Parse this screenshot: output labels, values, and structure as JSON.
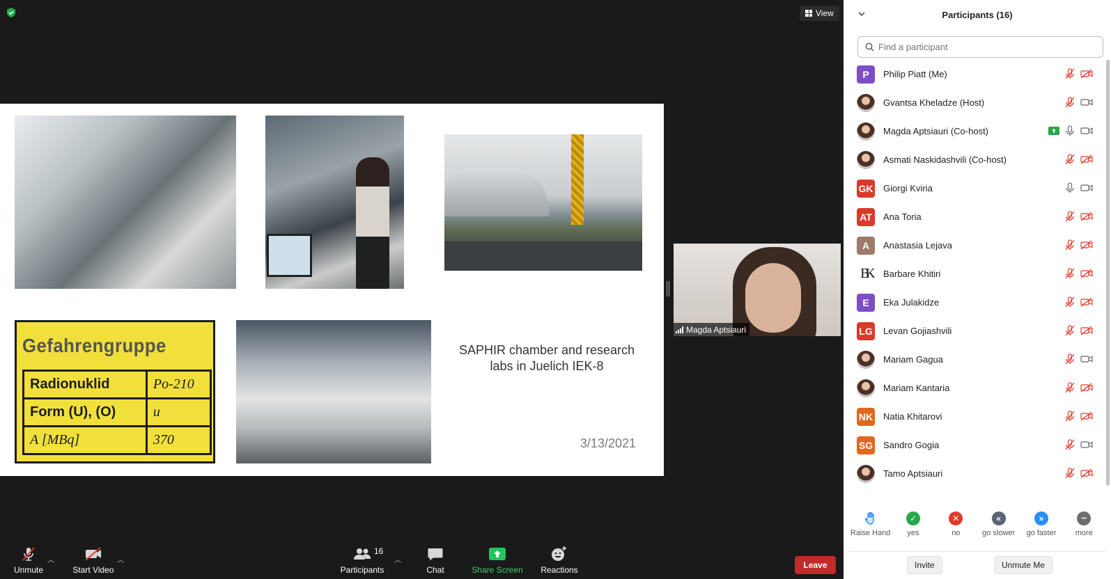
{
  "top": {
    "view_label": "View"
  },
  "slide": {
    "warning_title": "Gefahrengruppe",
    "warning_rows": [
      {
        "label": "Radionuklid",
        "value": "Po-210"
      },
      {
        "label": "Form (U), (O)",
        "value": "u"
      },
      {
        "label": "A [MBq]",
        "value": "370"
      }
    ],
    "caption": "SAPHIR chamber and research labs in Juelich IEK-8",
    "date": "3/13/2021"
  },
  "video_tile": {
    "name": "Magda Aptsiauri"
  },
  "toolbar": {
    "unmute": "Unmute",
    "start_video": "Start Video",
    "participants": "Participants",
    "participants_count": "16",
    "chat": "Chat",
    "share_screen": "Share Screen",
    "reactions": "Reactions",
    "leave": "Leave"
  },
  "panel": {
    "title": "Participants (16)",
    "search_placeholder": "Find a participant",
    "participants": [
      {
        "name": "Philip Piatt (Me)",
        "initials": "P",
        "color": "#7d4fc3",
        "mic": "muted",
        "video": "off"
      },
      {
        "name": "Gvantsa Kheladze (Host)",
        "initials": "",
        "color": "",
        "mic": "muted",
        "video": "on"
      },
      {
        "name": "Magda Aptsiauri (Co-host)",
        "initials": "",
        "color": "",
        "mic": "on",
        "video": "on",
        "sharing": true
      },
      {
        "name": "Asmati Naskidashvili (Co-host)",
        "initials": "",
        "color": "",
        "mic": "muted",
        "video": "off"
      },
      {
        "name": "Giorgi Kviria",
        "initials": "GK",
        "color": "#d93a2b",
        "mic": "on",
        "video": "on"
      },
      {
        "name": "Ana Toria",
        "initials": "AT",
        "color": "#d93a2b",
        "mic": "muted",
        "video": "off"
      },
      {
        "name": "Anastasia Lejava",
        "initials": "A",
        "color": "#9c7b6a",
        "mic": "muted",
        "video": "off"
      },
      {
        "name": "Barbare Khitiri",
        "initials": "BK",
        "color": "#ffffff",
        "mic": "muted",
        "video": "off"
      },
      {
        "name": "Eka Julakidze",
        "initials": "E",
        "color": "#7d4fc3",
        "mic": "muted",
        "video": "off"
      },
      {
        "name": "Levan Gojiashvili",
        "initials": "LG",
        "color": "#d93a2b",
        "mic": "muted",
        "video": "off"
      },
      {
        "name": "Mariam Gagua",
        "initials": "",
        "color": "",
        "mic": "muted",
        "video": "on"
      },
      {
        "name": "Mariam Kantaria",
        "initials": "",
        "color": "",
        "mic": "muted",
        "video": "off"
      },
      {
        "name": "Natia Khitarovi",
        "initials": "NK",
        "color": "#e0681f",
        "mic": "muted",
        "video": "off"
      },
      {
        "name": "Sandro Gogia",
        "initials": "SG",
        "color": "#e0681f",
        "mic": "muted",
        "video": "on"
      },
      {
        "name": "Tamo Aptsiauri",
        "initials": "",
        "color": "",
        "mic": "muted",
        "video": "off"
      }
    ],
    "reactions": [
      {
        "label": "Raise Hand",
        "icon": "raise-hand-icon"
      },
      {
        "label": "yes",
        "icon": "check-icon",
        "color": "#23a84a"
      },
      {
        "label": "no",
        "icon": "x-icon",
        "color": "#e0392b"
      },
      {
        "label": "go slower",
        "icon": "rewind-icon",
        "color": "#5a6472"
      },
      {
        "label": "go faster",
        "icon": "fast-forward-icon",
        "color": "#2d8cff"
      },
      {
        "label": "more",
        "icon": "more-icon",
        "color": "#6d6d6d"
      }
    ],
    "invite": "Invite",
    "unmute_me": "Unmute Me"
  }
}
